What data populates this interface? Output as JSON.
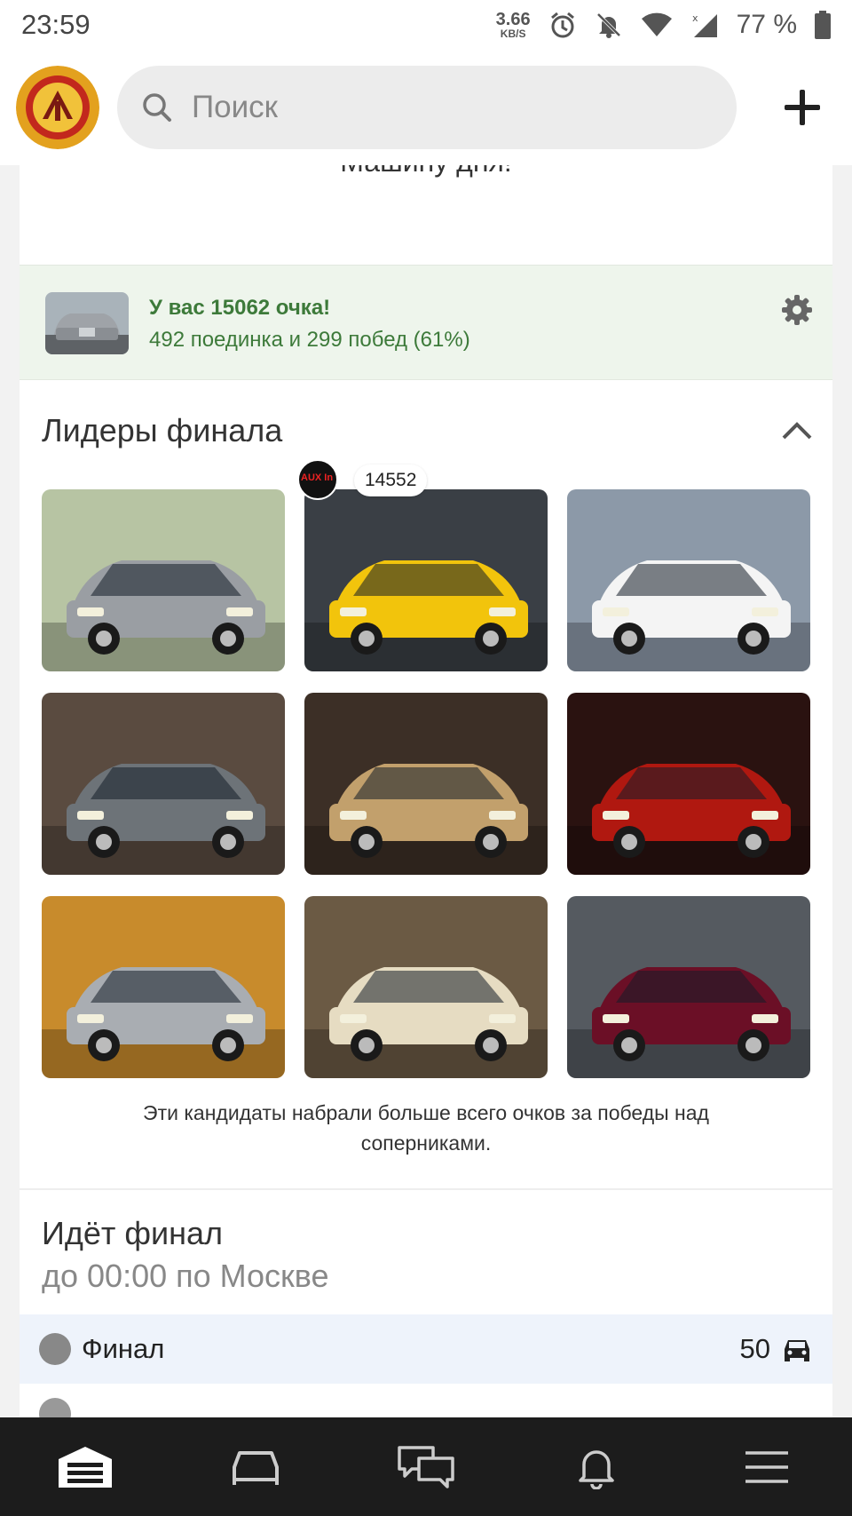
{
  "status_bar": {
    "time": "23:59",
    "net_speed": "3.66",
    "net_unit": "KB/S",
    "battery": "77 %"
  },
  "header": {
    "search_placeholder": "Поиск"
  },
  "feed": {
    "cut_text": "Машину дня!"
  },
  "score": {
    "title": "У вас 15062 очка!",
    "subtitle": "492 поединка и 299 побед (61%)"
  },
  "leaders": {
    "title": "Лидеры финала",
    "highlight_score": "14552",
    "owner_badge": "AUX In",
    "note": "Эти кандидаты набрали больше всего очков за победы над соперниками.",
    "cars": [
      {
        "color": "#9a9ea3",
        "bg": "#b7c4a3"
      },
      {
        "color": "#f2c40c",
        "bg": "#3a3f45"
      },
      {
        "color": "#f4f4f4",
        "bg": "#8c99a8"
      },
      {
        "color": "#6d7378",
        "bg": "#5a4b40"
      },
      {
        "color": "#c2a06c",
        "bg": "#3c2f26"
      },
      {
        "color": "#b01810",
        "bg": "#2a1210"
      },
      {
        "color": "#a9adb2",
        "bg": "#c88b2c"
      },
      {
        "color": "#e6dcc2",
        "bg": "#6b5a44"
      },
      {
        "color": "#6b0f26",
        "bg": "#555a60"
      }
    ]
  },
  "final": {
    "title": "Идёт финал",
    "subtitle": "до 00:00 по Москве",
    "row_label": "Финал",
    "row_count": "50"
  },
  "colors": {
    "accent_green": "#3d7a3a",
    "nav_bg": "#1c1c1c"
  }
}
